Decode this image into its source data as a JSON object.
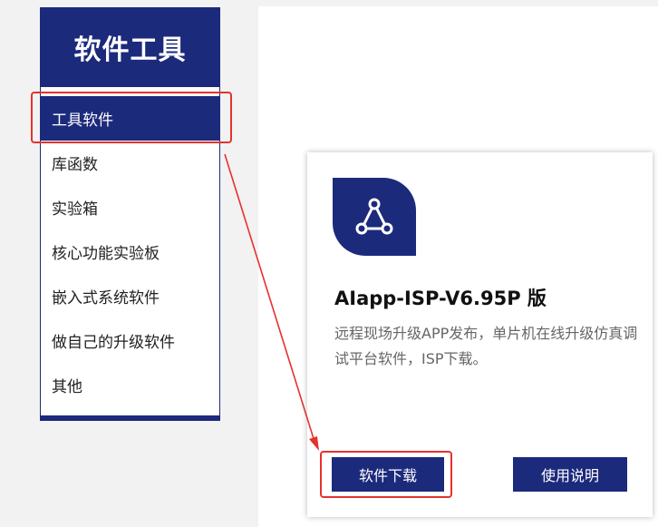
{
  "sidebar": {
    "title": "软件工具",
    "items": [
      {
        "label": "工具软件",
        "active": true
      },
      {
        "label": "库函数",
        "active": false
      },
      {
        "label": "实验箱",
        "active": false
      },
      {
        "label": "核心功能实验板",
        "active": false
      },
      {
        "label": "嵌入式系统软件",
        "active": false
      },
      {
        "label": "做自己的升级软件",
        "active": false
      },
      {
        "label": "其他",
        "active": false
      }
    ]
  },
  "card": {
    "icon": "share-network-icon",
    "title": "AIapp-ISP-V6.95P 版",
    "description": "远程现场升级APP发布，单片机在线升级仿真调试平台软件，ISP下载。",
    "download_label": "软件下载",
    "manual_label": "使用说明"
  },
  "colors": {
    "brand": "#1c2a7c",
    "annotation": "#e5322d"
  }
}
